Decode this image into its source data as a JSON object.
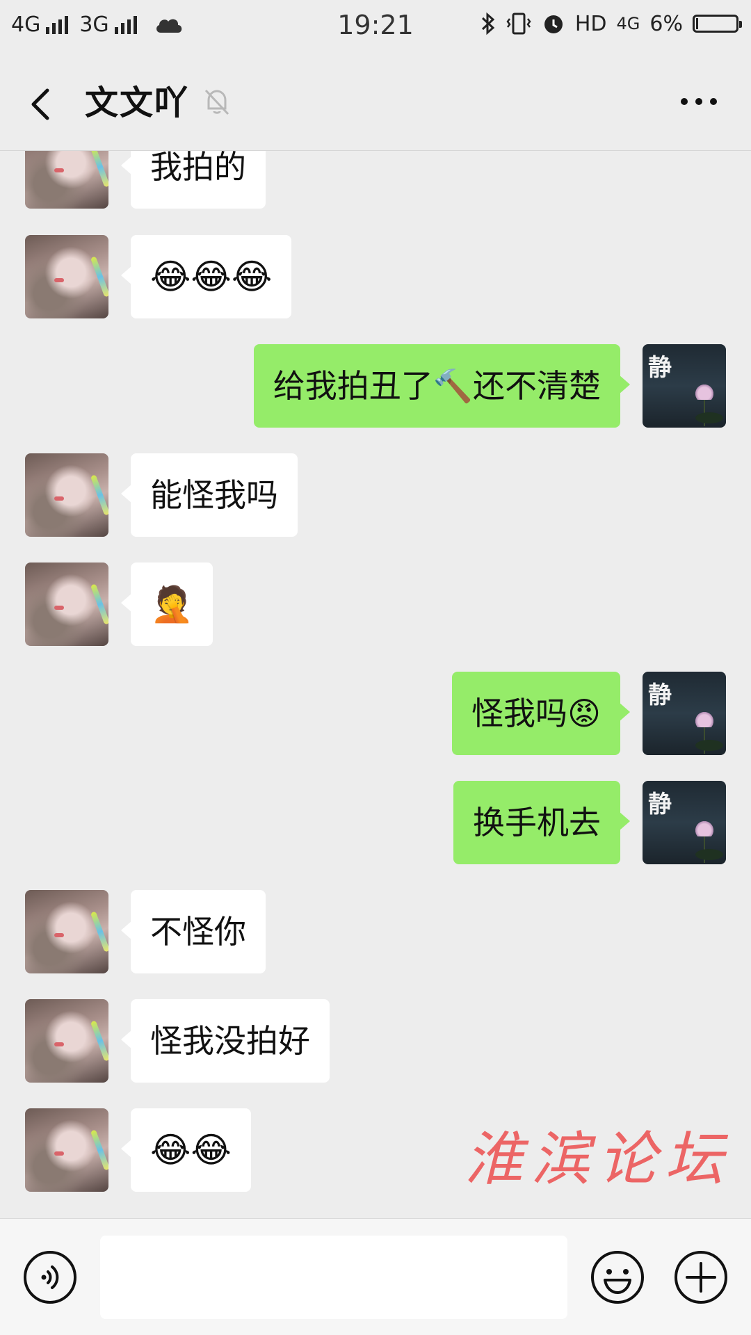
{
  "status_bar": {
    "network1": "4G",
    "network2": "3G",
    "time": "19:21",
    "hd": "HD",
    "network3": "4G",
    "battery": "6%",
    "battery_level": 0.06
  },
  "header": {
    "title": "文文吖"
  },
  "messages": [
    {
      "side": "left",
      "text": "我拍的"
    },
    {
      "side": "left",
      "text": "😂😂😂"
    },
    {
      "side": "right",
      "text": "给我拍丑了🔨还不清楚"
    },
    {
      "side": "left",
      "text": "能怪我吗"
    },
    {
      "side": "left",
      "text": "🤦"
    },
    {
      "side": "right",
      "text": "怪我吗😡"
    },
    {
      "side": "right",
      "text": "换手机去"
    },
    {
      "side": "left",
      "text": "不怪你"
    },
    {
      "side": "left",
      "text": "怪我没拍好"
    },
    {
      "side": "left",
      "text": "😂😂"
    }
  ],
  "watermark": "淮滨论坛",
  "input": {
    "value": "",
    "placeholder": ""
  },
  "colors": {
    "bubble_sent": "#95ec69",
    "bubble_received": "#ffffff",
    "background": "#ededed",
    "watermark": "#ec5a5a"
  }
}
